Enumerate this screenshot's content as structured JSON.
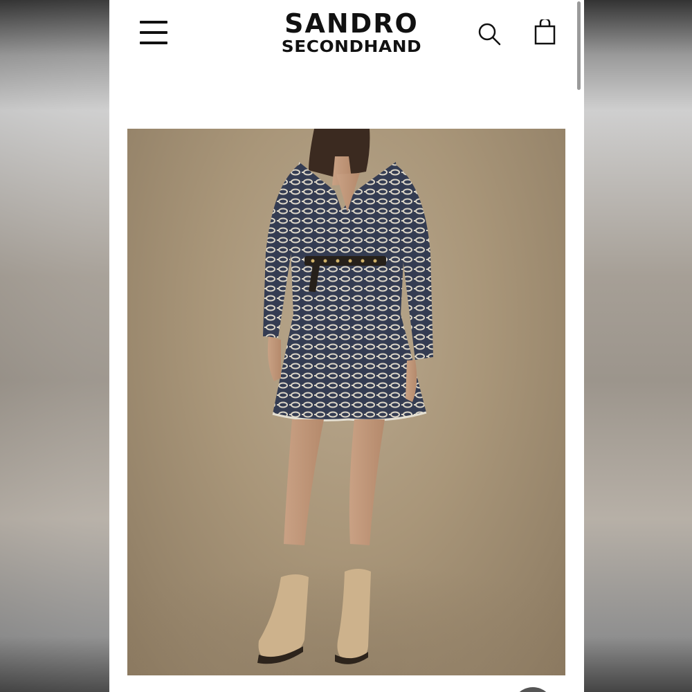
{
  "brand": {
    "line1": "SANDRO",
    "line2": "SECONDHAND"
  },
  "header": {
    "menu_icon": "hamburger-menu-icon",
    "search_icon": "search-icon",
    "bag_icon": "shopping-bag-icon"
  },
  "product_image": {
    "icon": "product-photo"
  },
  "colors": {
    "text": "#111111",
    "background": "#ffffff",
    "photo_backdrop": "#a99679",
    "dress": "#3a4257",
    "boots": "#cdb28c"
  }
}
